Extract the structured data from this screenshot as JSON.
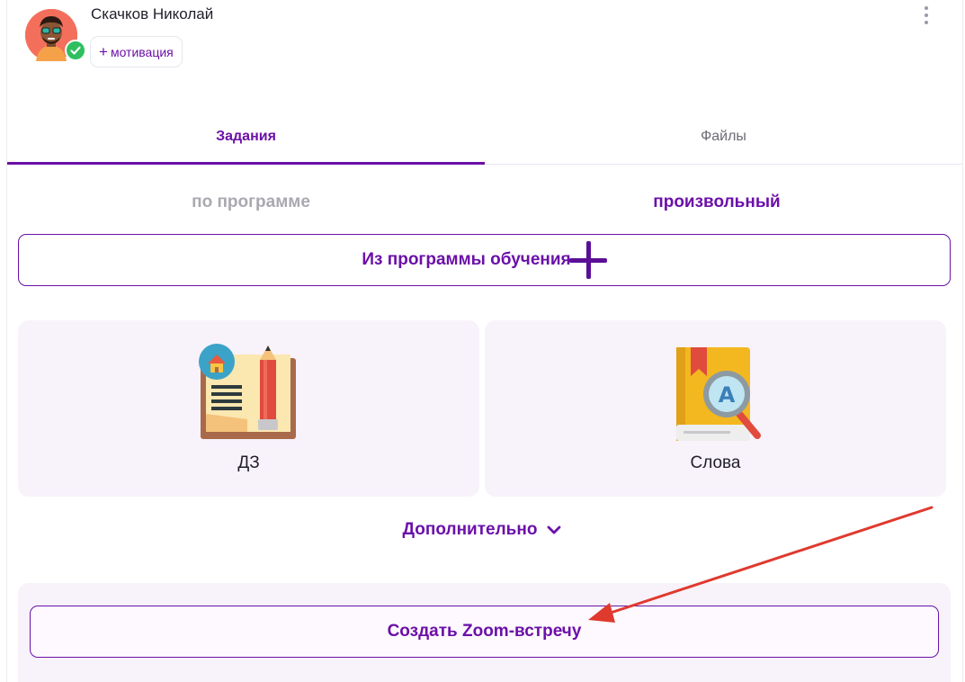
{
  "header": {
    "user_name": "Скачков Николай",
    "motivation_label": "мотивация",
    "motivation_plus": "+"
  },
  "tabs": [
    {
      "label": "Задания",
      "active": true
    },
    {
      "label": "Файлы",
      "active": false
    }
  ],
  "subtabs": [
    {
      "label": "по программе",
      "active": false
    },
    {
      "label": "произвольный",
      "active": true
    }
  ],
  "program_button": {
    "label": "Из программы обучения"
  },
  "cards": [
    {
      "label": "ДЗ",
      "icon": "homework-book-icon"
    },
    {
      "label": "Слова",
      "icon": "dictionary-search-icon"
    }
  ],
  "more_toggle": {
    "label": "Дополнительно"
  },
  "zoom": {
    "label": "Создать Zoom-встречу"
  },
  "colors": {
    "accent": "#6b10a8",
    "card_bg": "#f8f2fb",
    "annotation_arrow": "#e0392e",
    "verified": "#2fbf60"
  }
}
